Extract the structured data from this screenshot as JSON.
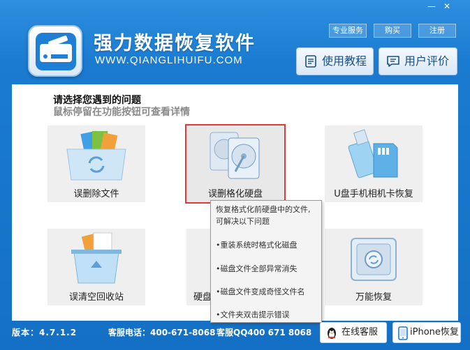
{
  "window": {
    "minimize_symbol": "—",
    "close_symbol": "✕"
  },
  "header": {
    "title": "强力数据恢复软件",
    "url": "WWW.QIANGLIHUIFU.COM",
    "links": {
      "pro_service": "专业服务",
      "buy": "购买",
      "register": "注册"
    },
    "tutorial_label": "使用教程",
    "review_label": "用户评价"
  },
  "main": {
    "prompt_title": "请选择您遇到的问题",
    "prompt_sub": "鼠标停留在功能按钮可查看详情",
    "cards": [
      {
        "label": "误删除文件",
        "icon": "folder-recycle-icon"
      },
      {
        "label": "误删格化硬盘",
        "icon": "hard-disk-icon"
      },
      {
        "label": "U盘手机相机卡恢复",
        "icon": "usb-sdcard-icon"
      },
      {
        "label": "误清空回收站",
        "icon": "recycle-bin-icon"
      },
      {
        "label": "硬盘",
        "icon": "hard-disk-partition-icon"
      },
      {
        "label": "万能恢复",
        "icon": "safe-box-icon"
      }
    ]
  },
  "tooltip": {
    "lines": [
      "恢复格式化前硬盘中的文件,",
      "可解决以下问题",
      "•重装系统时格式化磁盘",
      "•磁盘文件全部异常消失",
      "•磁盘文件变成奇怪文件名",
      "•文件夹双击提示错误"
    ]
  },
  "footer": {
    "version": "版本：4.7.1.2",
    "phone": "客服电话：400-671-8068",
    "qq": "客服QQ400 671 8068",
    "online_service": "在线客服",
    "iphone_recovery": "iPhone恢复"
  },
  "colors": {
    "accent": "#1a7bd1",
    "highlight_border": "#e03b3b"
  }
}
